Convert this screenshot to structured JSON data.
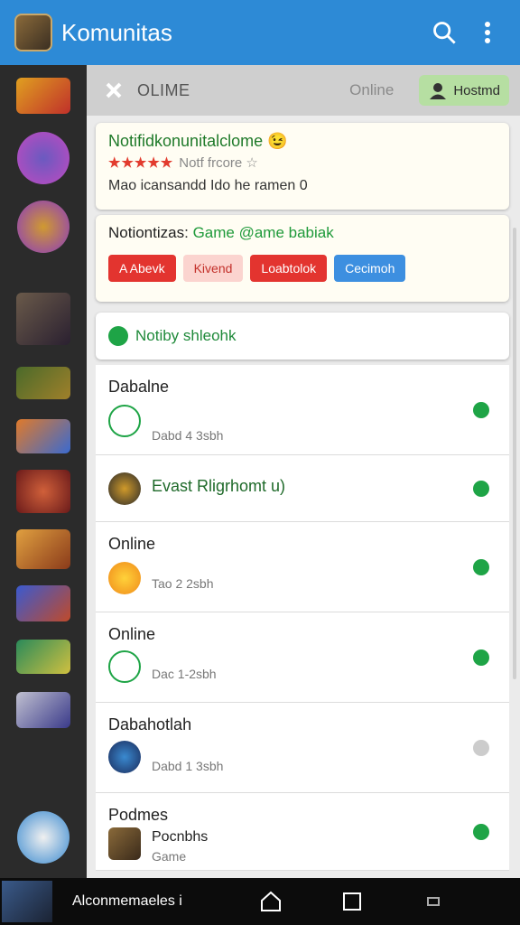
{
  "appbar": {
    "title": "Komunitas"
  },
  "topbar": {
    "label": "OLIME",
    "status": "Online",
    "chip": "Hostmd"
  },
  "card1": {
    "heading": "Notifidkonunitalclome 😉",
    "stars": "★★★★★",
    "rating_text": "Notf frcore ☆",
    "body": "Mao icansandd Ido he ramen 0"
  },
  "card2": {
    "heading_prefix": "Notiontizas:",
    "heading_highlight": "Game @ame babiak",
    "buttons": [
      "A Abevk",
      "Kivend",
      "Loabtolok",
      "Cecimoh"
    ]
  },
  "notify": {
    "label": "Notiby shleohk"
  },
  "rows": [
    {
      "name": "Dabalne",
      "sub": "Dabd 4 3sbh"
    },
    {
      "name": "Evast Rligrhomt u)",
      "sub": ""
    },
    {
      "name": "Online",
      "sub": "Tao 2 2sbh"
    },
    {
      "name": "Online",
      "sub": "Dac 1-2sbh"
    },
    {
      "name": "Dabahotlah",
      "sub": "Dabd 1 3sbh"
    },
    {
      "name": "Podmes",
      "title2": "Pocnbhs",
      "sub": "Game"
    }
  ],
  "navbar": {
    "label": "Alconmemaeles i"
  },
  "colors": {
    "primary": "#2d8ad6",
    "success": "#1ea446",
    "danger": "#e3342f"
  }
}
